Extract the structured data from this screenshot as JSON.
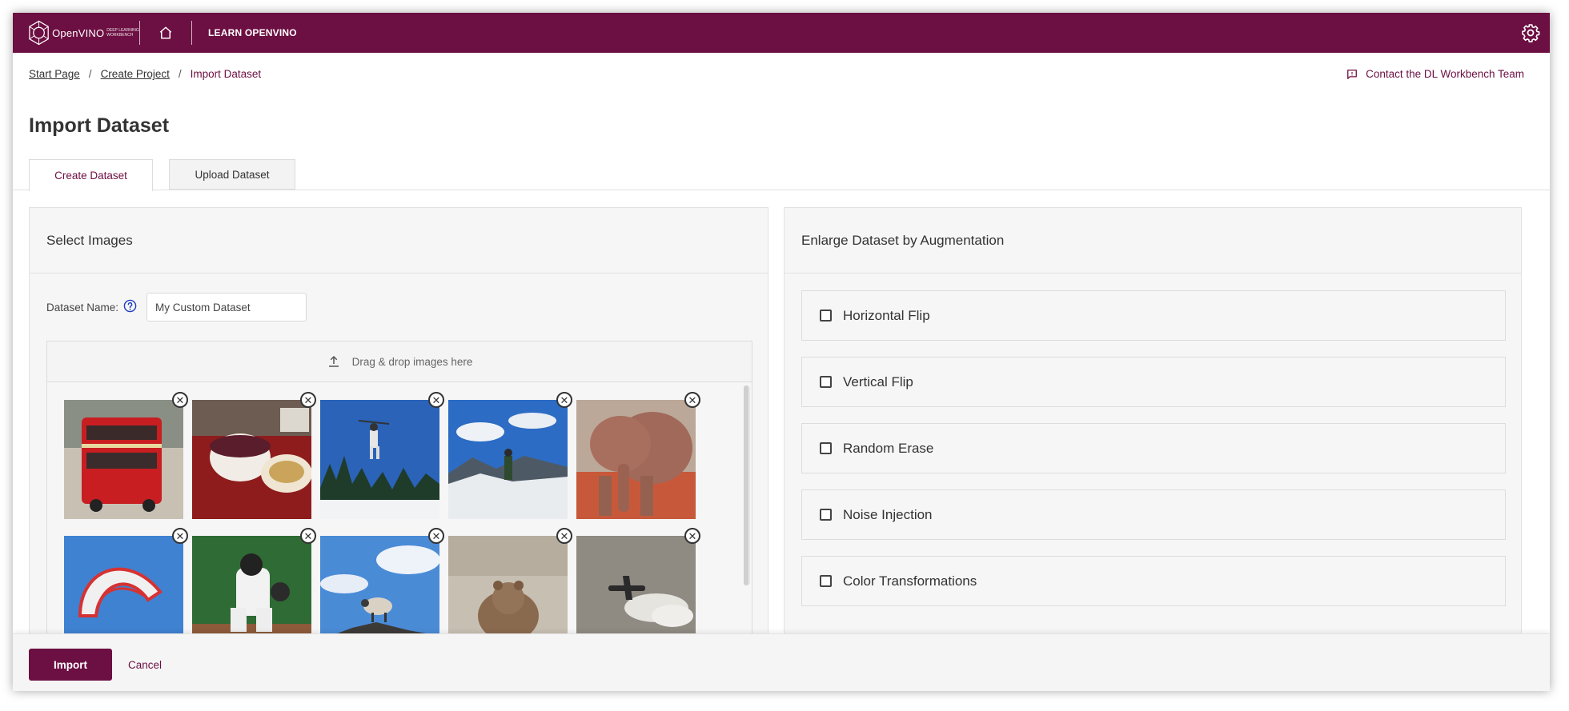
{
  "app": {
    "logo_text": "OpenVINO",
    "logo_sub": "DEEP LEARNING WORKBENCH",
    "learn_link": "LEARN OPENVINO",
    "brand_color": "#6c0f42"
  },
  "breadcrumb": {
    "items": [
      "Start Page",
      "Create Project"
    ],
    "current": "Import Dataset",
    "separator": "/"
  },
  "contact_link": "Contact the DL Workbench Team",
  "page_title": "Import Dataset",
  "tabs": [
    {
      "label": "Create Dataset",
      "active": true
    },
    {
      "label": "Upload Dataset",
      "active": false
    }
  ],
  "select_images": {
    "title": "Select Images",
    "dataset_name_label": "Dataset Name:",
    "dataset_name_value": "My Custom Dataset",
    "dropzone_text": "Drag & drop images here",
    "images": [
      "red-double-decker-bus",
      "table-with-cake",
      "freestyle-skier-jumping",
      "hiker-on-snowy-mountain",
      "elephants",
      "kite-in-blue-sky",
      "baseball-catcher",
      "sheep-on-rock",
      "bear-on-dirt",
      "airplane-in-cloudy-sky"
    ],
    "remove_glyph": "✕"
  },
  "augmentation": {
    "title": "Enlarge Dataset by Augmentation",
    "options": [
      {
        "label": "Horizontal Flip",
        "checked": false
      },
      {
        "label": "Vertical Flip",
        "checked": false
      },
      {
        "label": "Random Erase",
        "checked": false
      },
      {
        "label": "Noise Injection",
        "checked": false
      },
      {
        "label": "Color Transformations",
        "checked": false
      }
    ]
  },
  "footer": {
    "import_label": "Import",
    "cancel_label": "Cancel"
  }
}
